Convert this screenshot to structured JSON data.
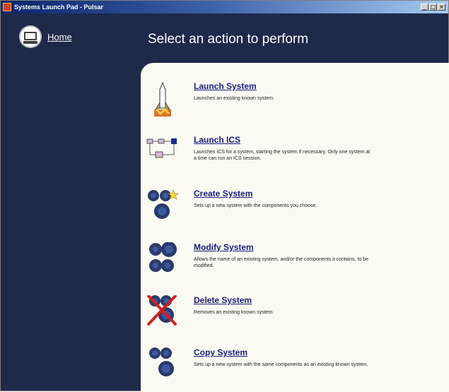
{
  "window": {
    "title": "Systems Launch Pad - Pulsar",
    "controls": [
      "_",
      "□",
      "×"
    ]
  },
  "nav": {
    "home_label": "Home",
    "home_icon": "home-computer-icon"
  },
  "header": {
    "title": "Select an action to perform"
  },
  "actions": [
    {
      "label": "Launch System",
      "description": "Launches an existing known system.",
      "icon": "rocket-icon"
    },
    {
      "label": "Launch ICS",
      "description": "Launches ICS for a system, starting the system if necessary. Only one system at a time can run an ICS session.",
      "icon": "ics-diagram-icon"
    },
    {
      "label": "Create System",
      "description": "Sets up a new system with the components you choose.",
      "icon": "create-system-icon"
    },
    {
      "label": "Modify System",
      "description": "Allows the name of an existing system, and/or the components it contains, to be modified.",
      "icon": "modify-system-icon"
    },
    {
      "label": "Delete System",
      "description": "Removes an existing known system.",
      "icon": "delete-system-icon"
    },
    {
      "label": "Copy System",
      "description": "Sets up a new system with the same components as an existing known system.",
      "icon": "copy-system-icon"
    }
  ],
  "colors": {
    "sidebar_bg": "#1e2a4a",
    "panel_bg": "#fafaf2",
    "link_color": "#1a1a7a"
  }
}
